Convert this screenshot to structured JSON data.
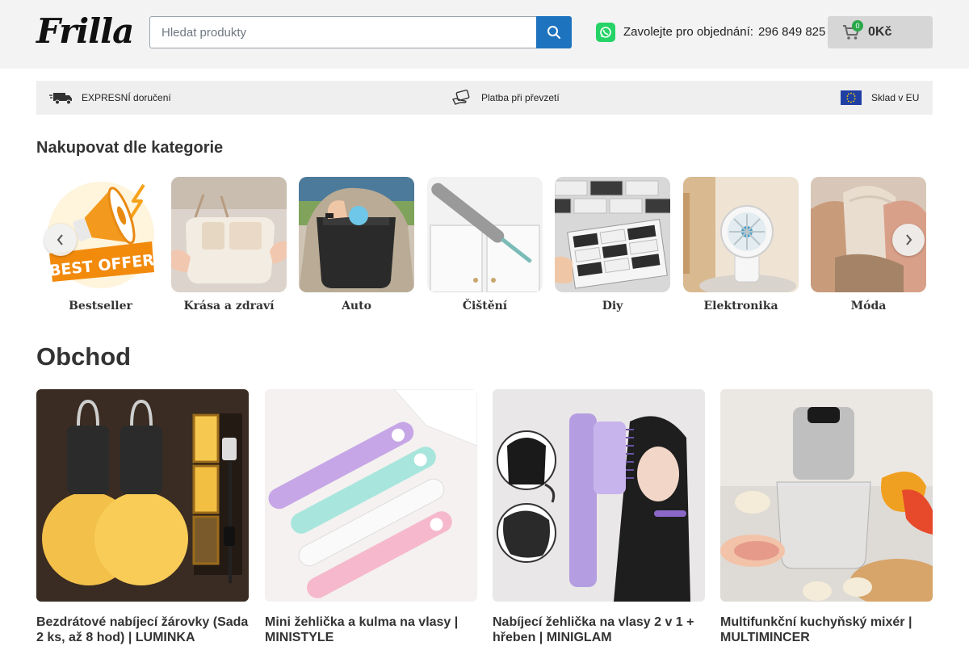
{
  "brand": {
    "logo_text": "Frilla"
  },
  "search": {
    "placeholder": "Hledat produkty"
  },
  "contact": {
    "label": "Zavolejte pro objednání:",
    "phone": "296 849 825"
  },
  "cart": {
    "count": "0",
    "total": "0Kč"
  },
  "infobar": {
    "delivery": "EXPRESNÍ doručení",
    "payment": "Platba při převzetí",
    "warehouse": "Sklad v EU"
  },
  "categories_section": {
    "title": "Nakupovat dle kategorie"
  },
  "categories": [
    {
      "label": "Bestseller",
      "image": "best-offer-megaphone"
    },
    {
      "label": "Krása a zdraví",
      "image": "cosmetic-bag"
    },
    {
      "label": "Auto",
      "image": "car-seat-organizer"
    },
    {
      "label": "Čištění",
      "image": "duster-brush"
    },
    {
      "label": "Diy",
      "image": "wall-tiles"
    },
    {
      "label": "Elektronika",
      "image": "desk-fan"
    },
    {
      "label": "Móda",
      "image": "wool-socks"
    }
  ],
  "carousel": {
    "prev_icon": "chevron-left-icon",
    "next_icon": "chevron-right-icon"
  },
  "shop": {
    "title": "Obchod"
  },
  "products": [
    {
      "name": "Bezdrátové nabíjecí žárovky (Sada 2 ks, až 8 hod) | LUMINKA",
      "image": "rechargeable-bulbs"
    },
    {
      "name": "Mini žehlička a kulma na vlasy | MINISTYLE",
      "image": "mini-hair-straighteners"
    },
    {
      "name": "Nabíjecí žehlička na vlasy 2 v 1 + hřeben | MINIGLAM",
      "image": "hair-straightener-comb"
    },
    {
      "name": "Multifunkční kuchyňský mixér | MULTIMINCER",
      "image": "kitchen-chopper"
    }
  ],
  "colors": {
    "accent": "#1e73be",
    "header_bg": "#f3f3f3",
    "infobar_bg": "#efefef",
    "cart_bg": "#d6d6d6",
    "badge": "#2aa84a",
    "whatsapp": "#25d366"
  }
}
